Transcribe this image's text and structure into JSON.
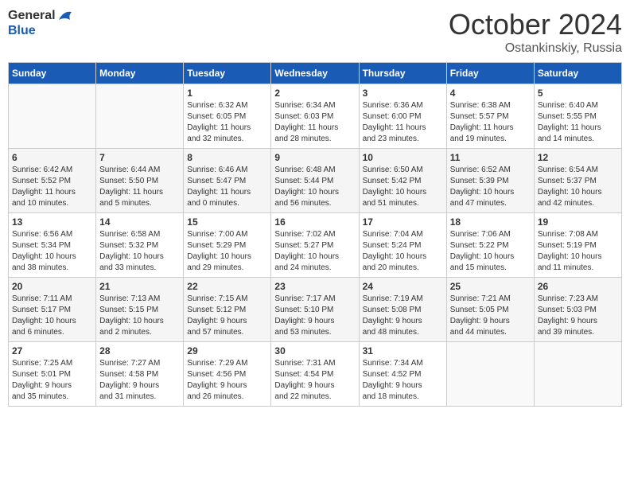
{
  "header": {
    "logo_line1": "General",
    "logo_line2": "Blue",
    "month": "October 2024",
    "location": "Ostankinskiy, Russia"
  },
  "weekdays": [
    "Sunday",
    "Monday",
    "Tuesday",
    "Wednesday",
    "Thursday",
    "Friday",
    "Saturday"
  ],
  "weeks": [
    [
      {
        "day": "",
        "info": ""
      },
      {
        "day": "",
        "info": ""
      },
      {
        "day": "1",
        "info": "Sunrise: 6:32 AM\nSunset: 6:05 PM\nDaylight: 11 hours\nand 32 minutes."
      },
      {
        "day": "2",
        "info": "Sunrise: 6:34 AM\nSunset: 6:03 PM\nDaylight: 11 hours\nand 28 minutes."
      },
      {
        "day": "3",
        "info": "Sunrise: 6:36 AM\nSunset: 6:00 PM\nDaylight: 11 hours\nand 23 minutes."
      },
      {
        "day": "4",
        "info": "Sunrise: 6:38 AM\nSunset: 5:57 PM\nDaylight: 11 hours\nand 19 minutes."
      },
      {
        "day": "5",
        "info": "Sunrise: 6:40 AM\nSunset: 5:55 PM\nDaylight: 11 hours\nand 14 minutes."
      }
    ],
    [
      {
        "day": "6",
        "info": "Sunrise: 6:42 AM\nSunset: 5:52 PM\nDaylight: 11 hours\nand 10 minutes."
      },
      {
        "day": "7",
        "info": "Sunrise: 6:44 AM\nSunset: 5:50 PM\nDaylight: 11 hours\nand 5 minutes."
      },
      {
        "day": "8",
        "info": "Sunrise: 6:46 AM\nSunset: 5:47 PM\nDaylight: 11 hours\nand 0 minutes."
      },
      {
        "day": "9",
        "info": "Sunrise: 6:48 AM\nSunset: 5:44 PM\nDaylight: 10 hours\nand 56 minutes."
      },
      {
        "day": "10",
        "info": "Sunrise: 6:50 AM\nSunset: 5:42 PM\nDaylight: 10 hours\nand 51 minutes."
      },
      {
        "day": "11",
        "info": "Sunrise: 6:52 AM\nSunset: 5:39 PM\nDaylight: 10 hours\nand 47 minutes."
      },
      {
        "day": "12",
        "info": "Sunrise: 6:54 AM\nSunset: 5:37 PM\nDaylight: 10 hours\nand 42 minutes."
      }
    ],
    [
      {
        "day": "13",
        "info": "Sunrise: 6:56 AM\nSunset: 5:34 PM\nDaylight: 10 hours\nand 38 minutes."
      },
      {
        "day": "14",
        "info": "Sunrise: 6:58 AM\nSunset: 5:32 PM\nDaylight: 10 hours\nand 33 minutes."
      },
      {
        "day": "15",
        "info": "Sunrise: 7:00 AM\nSunset: 5:29 PM\nDaylight: 10 hours\nand 29 minutes."
      },
      {
        "day": "16",
        "info": "Sunrise: 7:02 AM\nSunset: 5:27 PM\nDaylight: 10 hours\nand 24 minutes."
      },
      {
        "day": "17",
        "info": "Sunrise: 7:04 AM\nSunset: 5:24 PM\nDaylight: 10 hours\nand 20 minutes."
      },
      {
        "day": "18",
        "info": "Sunrise: 7:06 AM\nSunset: 5:22 PM\nDaylight: 10 hours\nand 15 minutes."
      },
      {
        "day": "19",
        "info": "Sunrise: 7:08 AM\nSunset: 5:19 PM\nDaylight: 10 hours\nand 11 minutes."
      }
    ],
    [
      {
        "day": "20",
        "info": "Sunrise: 7:11 AM\nSunset: 5:17 PM\nDaylight: 10 hours\nand 6 minutes."
      },
      {
        "day": "21",
        "info": "Sunrise: 7:13 AM\nSunset: 5:15 PM\nDaylight: 10 hours\nand 2 minutes."
      },
      {
        "day": "22",
        "info": "Sunrise: 7:15 AM\nSunset: 5:12 PM\nDaylight: 9 hours\nand 57 minutes."
      },
      {
        "day": "23",
        "info": "Sunrise: 7:17 AM\nSunset: 5:10 PM\nDaylight: 9 hours\nand 53 minutes."
      },
      {
        "day": "24",
        "info": "Sunrise: 7:19 AM\nSunset: 5:08 PM\nDaylight: 9 hours\nand 48 minutes."
      },
      {
        "day": "25",
        "info": "Sunrise: 7:21 AM\nSunset: 5:05 PM\nDaylight: 9 hours\nand 44 minutes."
      },
      {
        "day": "26",
        "info": "Sunrise: 7:23 AM\nSunset: 5:03 PM\nDaylight: 9 hours\nand 39 minutes."
      }
    ],
    [
      {
        "day": "27",
        "info": "Sunrise: 7:25 AM\nSunset: 5:01 PM\nDaylight: 9 hours\nand 35 minutes."
      },
      {
        "day": "28",
        "info": "Sunrise: 7:27 AM\nSunset: 4:58 PM\nDaylight: 9 hours\nand 31 minutes."
      },
      {
        "day": "29",
        "info": "Sunrise: 7:29 AM\nSunset: 4:56 PM\nDaylight: 9 hours\nand 26 minutes."
      },
      {
        "day": "30",
        "info": "Sunrise: 7:31 AM\nSunset: 4:54 PM\nDaylight: 9 hours\nand 22 minutes."
      },
      {
        "day": "31",
        "info": "Sunrise: 7:34 AM\nSunset: 4:52 PM\nDaylight: 9 hours\nand 18 minutes."
      },
      {
        "day": "",
        "info": ""
      },
      {
        "day": "",
        "info": ""
      }
    ]
  ]
}
